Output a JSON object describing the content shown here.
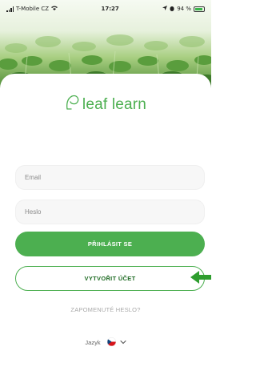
{
  "status_bar": {
    "carrier": "T-Mobile CZ",
    "time": "17:27",
    "battery": "94 %"
  },
  "brand": {
    "name": "leaf learn"
  },
  "form": {
    "email_placeholder": "Email",
    "password_placeholder": "Heslo",
    "login_label": "PŘIHLÁSIT SE",
    "register_label": "VYTVOŘIT ÚČET",
    "forgot_label": "ZAPOMENUTÉ HESLO?"
  },
  "language": {
    "label": "Jazyk",
    "selected_flag": "czech-flag"
  },
  "colors": {
    "accent": "#4caf50",
    "annotation_arrow": "#2e9d2e"
  }
}
